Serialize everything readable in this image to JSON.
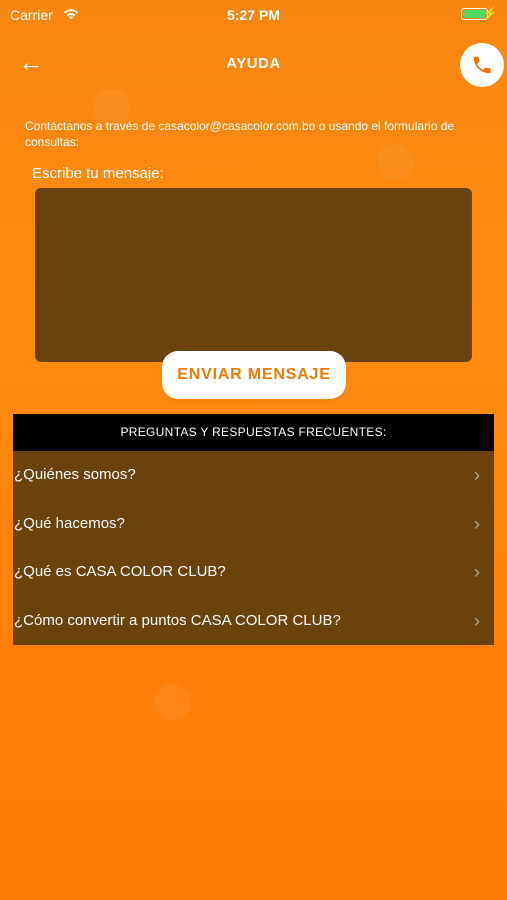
{
  "status_bar": {
    "carrier": "Carrier",
    "time": "5:27 PM",
    "battery_color": "#4cd964"
  },
  "header": {
    "title": "AYUDA",
    "back_icon": "back-arrow-icon",
    "action_icon": "phone-icon"
  },
  "contact": {
    "text": "Contáctanos a través de casacolor@casacolor.com.bo o usando el formulario de consultas:",
    "message_label": "Escribe tu mensaje:",
    "message_value": "",
    "send_label": "ENVIAR MENSAJE"
  },
  "faq": {
    "title": "PREGUNTAS Y RESPUESTAS FRECUENTES:",
    "items": [
      {
        "label": "¿Quiénes somos?"
      },
      {
        "label": "¿Qué hacemos?"
      },
      {
        "label": "¿Qué es CASA COLOR CLUB?"
      },
      {
        "label": "¿Cómo convertir a puntos CASA COLOR CLUB?"
      }
    ]
  },
  "theme": {
    "background": "#ff8c11",
    "accent": "#f47b00",
    "panel": "#54390d",
    "header_bar": "#000000"
  }
}
